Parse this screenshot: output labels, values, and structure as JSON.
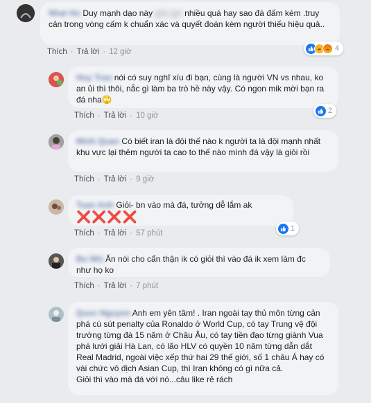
{
  "comments": [
    {
      "author": "Nhat Ho",
      "text_after_name": "Duy mạnh dạo này",
      "text_blurred": "ghe gie",
      "text_mid": "nhiều quá hay sao đá đấm kém",
      "text_rest": ".truy cản trong vòng cấm k chuẩn xác và quyết đoán kèm người thiếu hiệu quả..",
      "like_label": "Thích",
      "reply_label": "Trả lời",
      "time": "12 giờ",
      "reaction_count": "4"
    },
    {
      "author": "Huy Tran",
      "text": "nói có suy nghĩ xíu đi bạn, cùng là người VN vs nhau, ko an ủi thì thôi, nẵc gì làm ba trò hề này vậy. Có ngon mik mời bạn ra đá nha",
      "emoji": "🙄",
      "like_label": "Thích",
      "reply_label": "Trả lời",
      "time": "10 giờ",
      "reaction_count": "2"
    },
    {
      "author": "Minh Quan",
      "text": "Có biết iran là đội thế nào k người ta là đội mạnh nhất khu vực lại thêm người ta cao to thế nào mình đá vậy là giỏi rồi",
      "like_label": "Thích",
      "reply_label": "Trả lời",
      "time": "9 giờ"
    },
    {
      "author": "Tuan Anh",
      "text": "Giỏi- bn vào mà đá, tưởng dễ lắm ak",
      "marks": "❌❌❌❌",
      "like_label": "Thích",
      "reply_label": "Trả lời",
      "time": "57 phút",
      "reaction_count": "1"
    },
    {
      "author": "Đu Nhị",
      "text": "Ăn nói cho cẩn thận ik có giỏi thì vào đá ik xem làm đc như họ ko",
      "like_label": "Thích",
      "reply_label": "Trả lời",
      "time": "7 phút"
    },
    {
      "author": "Quoc Nguyen",
      "text_first": "Anh em yên tâm! . Iran ngoài tay thủ môn từng cản phá cú sút penalty của Ronaldo ở World Cup, có tay Trung vệ đội trưởng từng đá 15 năm ở Châu Âu, có tay tiền đạo từng giành Vua phá lưới giải Hà Lan, có lão HLV có quyền 10 năm từng dẫn dắt Real Madrid, ngoài việc xếp thứ hai 29 thế giới, số 1 châu Á hay có vài chức vô địch Asian Cup, thì Iran không có gì nữa cả.",
      "text_last": "Giỏi thì vào mà đá với nó...câu like rẻ rách"
    }
  ]
}
